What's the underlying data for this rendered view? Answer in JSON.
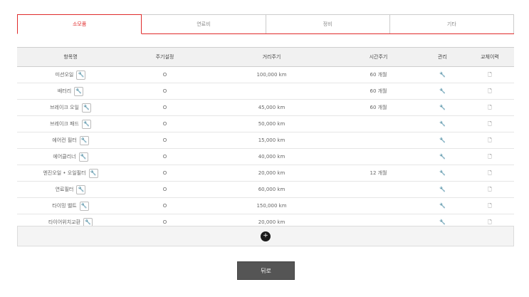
{
  "tabs": [
    {
      "label": "소모품",
      "active": true
    },
    {
      "label": "연료비",
      "active": false
    },
    {
      "label": "정비",
      "active": false
    },
    {
      "label": "기타",
      "active": false
    }
  ],
  "table": {
    "headers": [
      "항목명",
      "주기설정",
      "거리주기",
      "시간주기",
      "관리",
      "교체이력"
    ],
    "rows": [
      {
        "name": "미션오일",
        "cycle": "O",
        "distance": "100,000 km",
        "time": "60 개월"
      },
      {
        "name": "배터리",
        "cycle": "O",
        "distance": "",
        "time": "60 개월"
      },
      {
        "name": "브레이크 오일",
        "cycle": "O",
        "distance": "45,000 km",
        "time": "60 개월"
      },
      {
        "name": "브레이크 패드",
        "cycle": "O",
        "distance": "50,000 km",
        "time": ""
      },
      {
        "name": "에어컨 필터",
        "cycle": "O",
        "distance": "15,000 km",
        "time": ""
      },
      {
        "name": "에어클리너",
        "cycle": "O",
        "distance": "40,000 km",
        "time": ""
      },
      {
        "name": "엔진오일 • 오일필터",
        "cycle": "O",
        "distance": "20,000 km",
        "time": "12 개월"
      },
      {
        "name": "연료필터",
        "cycle": "O",
        "distance": "60,000 km",
        "time": ""
      },
      {
        "name": "타이밍 벨트",
        "cycle": "O",
        "distance": "150,000 km",
        "time": ""
      },
      {
        "name": "타이어위치교환",
        "cycle": "O",
        "distance": "20,000 km",
        "time": ""
      }
    ]
  },
  "icons": {
    "edit": "wrench-icon",
    "manage": "wrench-icon",
    "history": "document-icon",
    "add": "plus-icon"
  },
  "glyphs": {
    "wrench": "🔧",
    "document": "🗋",
    "plus": "+"
  },
  "back_label": "뒤로",
  "colors": {
    "accent": "#e02b2b",
    "button": "#555555"
  }
}
